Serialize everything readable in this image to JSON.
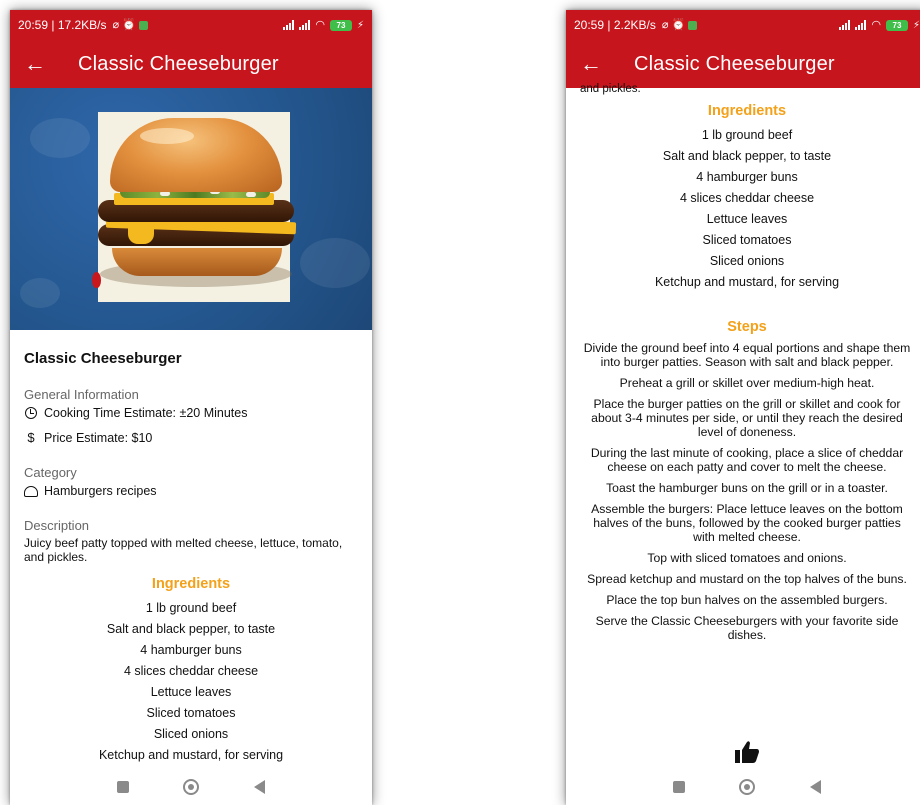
{
  "colors": {
    "app_bar": "#c7151d",
    "accent_heading": "#f4a11a",
    "hero_background": "#24578f"
  },
  "screens": [
    {
      "status_bar": {
        "time_speed": "20:59 | 17.2KB/s",
        "battery": "73"
      },
      "app_bar": {
        "title": "Classic Cheeseburger",
        "back_icon": "arrow-left"
      },
      "hero_image": "cheeseburger-photo",
      "recipe_title": "Classic Cheeseburger",
      "general_info": {
        "label": "General Information",
        "cooking_time": "Cooking Time Estimate: ±20 Minutes",
        "price": "Price Estimate: $10"
      },
      "category": {
        "label": "Category",
        "value": "Hamburgers recipes"
      },
      "description": {
        "label": "Description",
        "text": "Juicy beef patty topped with melted cheese, lettuce, tomato, and pickles."
      }
    },
    {
      "status_bar": {
        "time_speed": "20:59 | 2.2KB/s",
        "battery": "73"
      },
      "app_bar": {
        "title": "Classic Cheeseburger",
        "back_icon": "arrow-left"
      },
      "clipped_text": "and pickles.",
      "steps_heading": "Steps",
      "steps": [
        "Divide the ground beef into 4 equal portions and shape them into burger patties. Season with salt and black pepper.",
        "Preheat a grill or skillet over medium-high heat.",
        "Place the burger patties on the grill or skillet and cook for about 3-4 minutes per side, or until they reach the desired level of doneness.",
        "During the last minute of cooking, place a slice of cheddar cheese on each patty and cover to melt the cheese.",
        "Toast the hamburger buns on the grill or in a toaster.",
        "Assemble the burgers: Place lettuce leaves on the bottom halves of the buns, followed by the cooked burger patties with melted cheese.",
        "Top with sliced tomatoes and onions.",
        "Spread ketchup and mustard on the top halves of the buns.",
        "Place the top bun halves on the assembled burgers.",
        "Serve the Classic Cheeseburgers with your favorite side dishes."
      ]
    }
  ],
  "ingredients": {
    "heading": "Ingredients",
    "items": [
      "1 lb ground beef",
      "Salt and black pepper, to taste",
      "4 hamburger buns",
      "4 slices cheddar cheese",
      "Lettuce leaves",
      "Sliced tomatoes",
      "Sliced onions",
      "Ketchup and mustard, for serving"
    ]
  }
}
